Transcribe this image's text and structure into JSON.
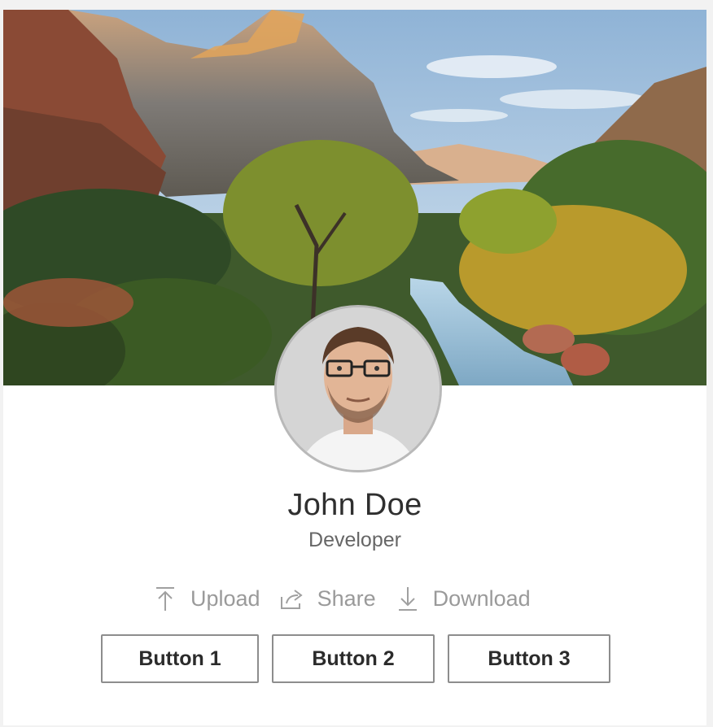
{
  "profile": {
    "name": "John Doe",
    "role": "Developer"
  },
  "actions": [
    {
      "label": "Upload",
      "icon": "upload-icon"
    },
    {
      "label": "Share",
      "icon": "share-icon"
    },
    {
      "label": "Download",
      "icon": "download-icon"
    }
  ],
  "buttons": [
    "Button 1",
    "Button 2",
    "Button 3"
  ],
  "colors": {
    "card_bg": "#ffffff",
    "page_bg": "#f2f2f2",
    "name_text": "#2f2f2f",
    "action_text": "#9a9a9a",
    "button_border": "#8d8d8d"
  }
}
